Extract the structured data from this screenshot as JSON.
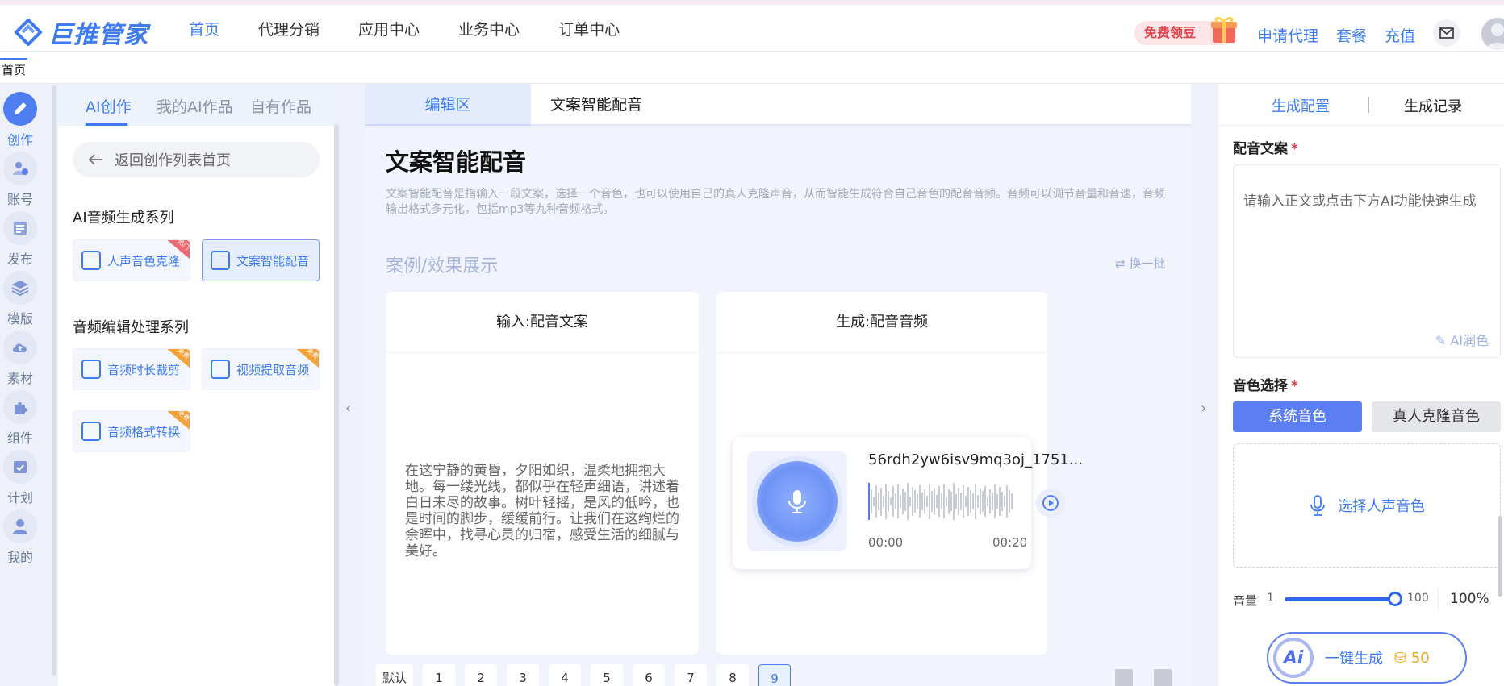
{
  "brand": {
    "name": "巨推管家",
    "color": "#3e7bf0"
  },
  "nav": {
    "items": [
      "首页",
      "代理分销",
      "应用中心",
      "业务中心",
      "订单中心"
    ],
    "active": 0
  },
  "header": {
    "promo": "免费领豆",
    "links": [
      "申请代理",
      "套餐",
      "充值"
    ],
    "icons": [
      "mail-icon",
      "avatar"
    ]
  },
  "tabstrip": {
    "tab": "首页"
  },
  "rail": {
    "items": [
      {
        "label": "创作",
        "icon": "pencil-icon"
      },
      {
        "label": "账号",
        "icon": "user-add-icon"
      },
      {
        "label": "发布",
        "icon": "publish-icon"
      },
      {
        "label": "模版",
        "icon": "layers-icon"
      },
      {
        "label": "素材",
        "icon": "cloud-icon"
      },
      {
        "label": "组件",
        "icon": "puzzle-icon"
      },
      {
        "label": "计划",
        "icon": "calendar-check-icon"
      },
      {
        "label": "我的",
        "icon": "person-icon"
      }
    ]
  },
  "panel2": {
    "tabs": [
      "AI创作",
      "我的AI作品",
      "自有作品"
    ],
    "back": "返回创作列表首页",
    "section1": "AI音频生成系列",
    "tools1": [
      {
        "label": "人声音色克隆",
        "badge": "热门"
      },
      {
        "label": "文案智能配音",
        "badge": ""
      }
    ],
    "section2": "音频编辑处理系列",
    "tools2": [
      {
        "label": "音频时长裁剪",
        "badge": "免费"
      },
      {
        "label": "视频提取音频",
        "badge": "免费"
      },
      {
        "label": "音频格式转换",
        "badge": "免费"
      }
    ]
  },
  "center": {
    "tabs": [
      "编辑区",
      "文案智能配音"
    ],
    "title": "文案智能配音",
    "desc": "文案智能配音是指输入一段文案，选择一个音色，也可以使用自己的真人克隆声音，从而智能生成符合自己音色的配音音频。音频可以调节音量和音速，音频输出格式多元化，包括mp3等九种音频格式。",
    "case_title": "案例/效果展示",
    "swap": "换一批",
    "input_card": {
      "title": "输入:配音文案",
      "text": "在这宁静的黄昏，夕阳如织，温柔地拥抱大地。每一缕光线，都似乎在轻声细语，讲述着白日未尽的故事。树叶轻摇，是风的低吟，也是时间的脚步，缓缓前行。让我们在这绚烂的余晖中，找寻心灵的归宿，感受生活的细腻与美好。"
    },
    "output_card": {
      "title": "生成:配音音频",
      "file": "56rdh2yw6isv9mq3oj_1751...",
      "start": "00:00",
      "end": "00:20"
    },
    "pager": {
      "items": [
        "默认",
        "1",
        "2",
        "3",
        "4",
        "5",
        "6",
        "7",
        "8",
        "9"
      ],
      "active": "9"
    }
  },
  "right": {
    "tabs": [
      "生成配置",
      "生成记录"
    ],
    "text_label": "配音文案",
    "placeholder": "请输入正文或点击下方AI功能快速生成",
    "ai_polish": "AI润色",
    "voice_label": "音色选择",
    "voice_tabs": [
      "系统音色",
      "真人克隆音色"
    ],
    "voice_pick": "选择人声音色",
    "volume": {
      "label": "音量",
      "min": "1",
      "max": "100",
      "value": "100%",
      "level": 100
    },
    "generate": {
      "badge": "Ai",
      "label": "一键生成",
      "cost": "50"
    }
  }
}
